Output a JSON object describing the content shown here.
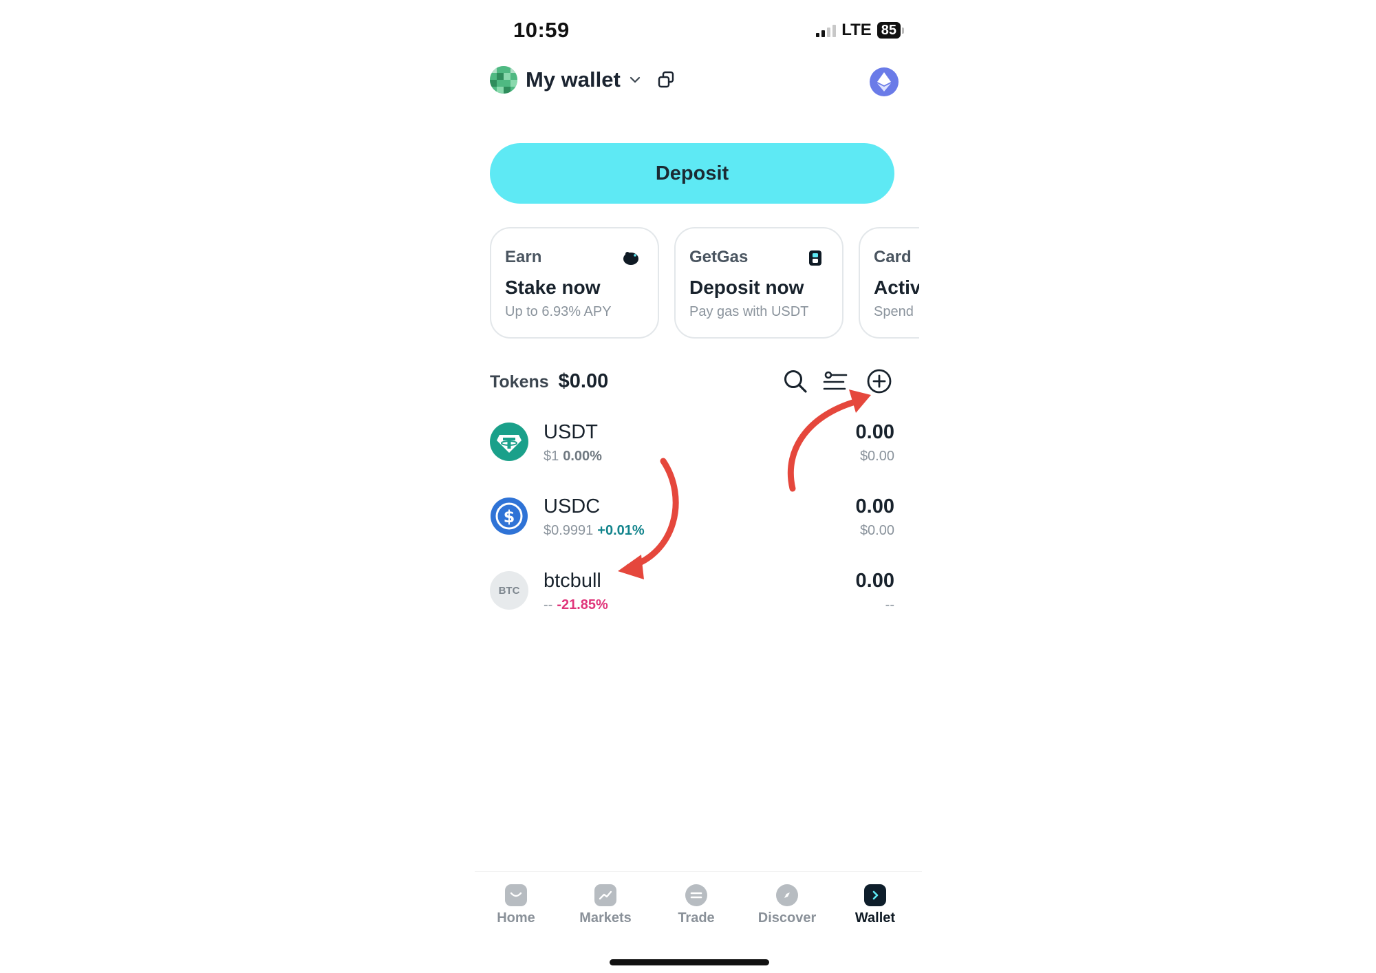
{
  "status": {
    "time": "10:59",
    "network": "LTE",
    "battery": "85"
  },
  "header": {
    "wallet_name": "My wallet"
  },
  "deposit_label": "Deposit",
  "cards": [
    {
      "label": "Earn",
      "title": "Stake now",
      "subtitle": "Up to 6.93% APY",
      "icon": "piggy-bank-icon"
    },
    {
      "label": "GetGas",
      "title": "Deposit now",
      "subtitle": "Pay gas with USDT",
      "icon": "fuel-icon"
    },
    {
      "label": "Card",
      "title": "Activ",
      "subtitle": "Spend"
    }
  ],
  "tokens": {
    "label": "Tokens",
    "total": "$0.00",
    "items": [
      {
        "symbol": "USDT",
        "price": "$1",
        "change": "0.00%",
        "amount": "0.00",
        "fiat": "$0.00"
      },
      {
        "symbol": "USDC",
        "price": "$0.9991",
        "change": "+0.01%",
        "amount": "0.00",
        "fiat": "$0.00"
      },
      {
        "symbol": "btcbull",
        "logo_text": "BTC",
        "price": "--",
        "change": "-21.85%",
        "amount": "0.00",
        "fiat": "--"
      }
    ]
  },
  "nav": [
    {
      "label": "Home",
      "icon": "home-icon"
    },
    {
      "label": "Markets",
      "icon": "markets-icon"
    },
    {
      "label": "Trade",
      "icon": "trade-icon"
    },
    {
      "label": "Discover",
      "icon": "compass-icon"
    },
    {
      "label": "Wallet",
      "icon": "wallet-icon",
      "active": true
    }
  ],
  "colors": {
    "accent": "#5ee9f4",
    "positive": "#12848c",
    "negative": "#e0357a",
    "annotation": "#e5473c"
  }
}
